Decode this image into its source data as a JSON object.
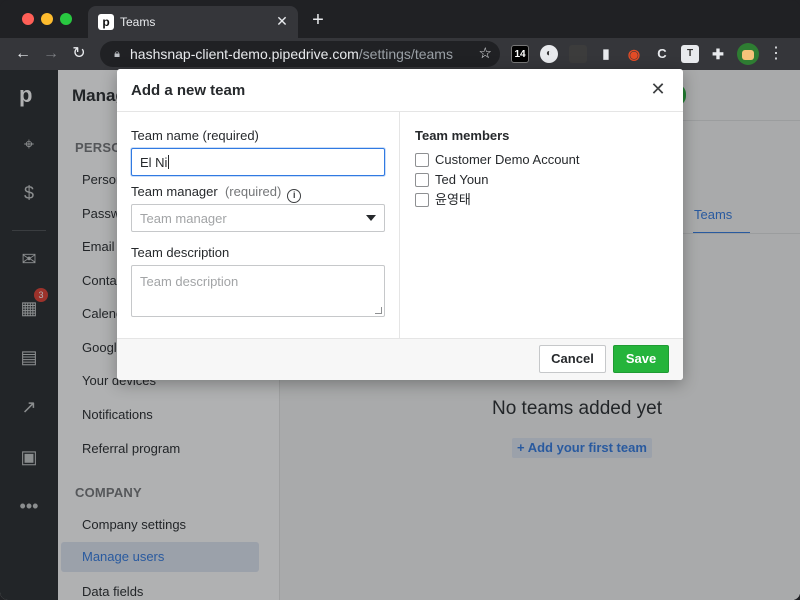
{
  "browser": {
    "tab_title": "Teams",
    "tab_favicon": "p",
    "url_host": "hashsnap-client-demo.pipedrive.com",
    "url_path": "/settings/teams",
    "ext_14": "14",
    "ext_trello": "T"
  },
  "left_nav": {
    "logo": "p",
    "badge_count": "3"
  },
  "settings_nav": {
    "page_heading": "Manag",
    "section_personal": "PERSON",
    "items_personal": [
      "Person",
      "Passw",
      "Email s",
      "Contac",
      "Calend",
      "Google",
      "Your devices",
      "Notifications",
      "Referral program"
    ],
    "section_company": "COMPANY",
    "company_settings": "Company settings",
    "manage_users": "Manage users",
    "data_fields": "Data fields"
  },
  "main": {
    "tab_teams": "Teams",
    "empty_title": "No teams added yet",
    "add_first_team": "+ Add your first team"
  },
  "modal": {
    "title": "Add a new team",
    "team_name_label": "Team name (required)",
    "team_name_value": "El Ni",
    "team_manager_label": "Team manager",
    "team_manager_required": "(required)",
    "team_manager_placeholder": "Team manager",
    "team_description_label": "Team description",
    "team_description_placeholder": "Team description",
    "members_heading": "Team members",
    "members": [
      "Customer Demo Account",
      "Ted Youn",
      "윤영태"
    ],
    "cancel_label": "Cancel",
    "save_label": "Save",
    "info_glyph": "i"
  },
  "colors": {
    "accent_blue": "#317ae2",
    "save_green": "#25b43b",
    "sidebar_dark": "#26292c",
    "badge_red": "#e03c31"
  }
}
